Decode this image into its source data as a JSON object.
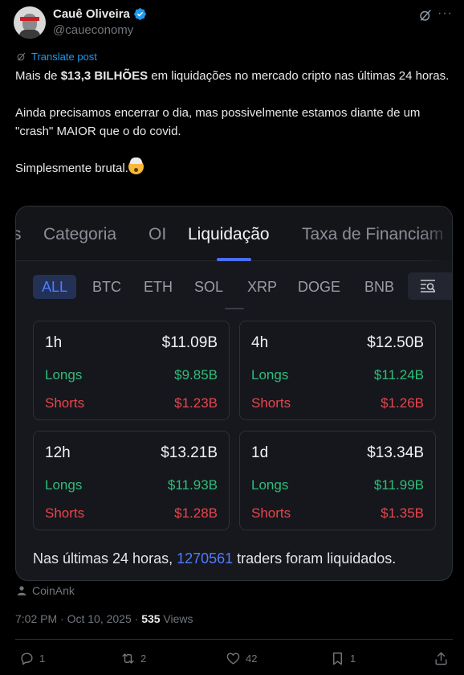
{
  "author": {
    "name": "Cauê Oliveira",
    "handle": "@caueconomy"
  },
  "translate_label": "Translate post",
  "tweet": {
    "p1_prefix": "Mais de ",
    "p1_bold": "$13,3 BILHÕES",
    "p1_suffix": " em liquidações no mercado cripto nas últimas 24 horas.",
    "p2": "Ainda precisamos encerrar o dia, mas possivelmente estamos diante de um \"crash\" MAIOR que o do covid.",
    "p3": "Simplesmente brutal."
  },
  "media": {
    "tabs": [
      "s",
      "Categoria",
      "OI",
      "Liquidação",
      "Taxa de Financiam"
    ],
    "active_tab": "Liquidação",
    "coins": [
      "ALL",
      "BTC",
      "ETH",
      "SOL",
      "XRP",
      "DOGE",
      "BNB"
    ],
    "active_coin": "ALL",
    "cards": [
      {
        "period": "1h",
        "total": "$11.09B",
        "longs_label": "Longs",
        "longs": "$9.85B",
        "shorts_label": "Shorts",
        "shorts": "$1.23B"
      },
      {
        "period": "4h",
        "total": "$12.50B",
        "longs_label": "Longs",
        "longs": "$11.24B",
        "shorts_label": "Shorts",
        "shorts": "$1.26B"
      },
      {
        "period": "12h",
        "total": "$13.21B",
        "longs_label": "Longs",
        "longs": "$11.93B",
        "shorts_label": "Shorts",
        "shorts": "$1.28B"
      },
      {
        "period": "1d",
        "total": "$13.34B",
        "longs_label": "Longs",
        "longs": "$11.99B",
        "shorts_label": "Shorts",
        "shorts": "$1.35B"
      }
    ],
    "summary_prefix": "Nas últimas 24 horas, ",
    "summary_count": "1270561",
    "summary_suffix": " traders foram liquidados."
  },
  "source": "CoinAnk",
  "meta": {
    "timestamp": "7:02 PM · Oct 10, 2025 · ",
    "views_count": "535",
    "views_label": " Views"
  },
  "actions": {
    "replies": "1",
    "reposts": "2",
    "likes": "42",
    "bookmarks": "1"
  },
  "colors": {
    "accent": "#1d9bf0",
    "longs": "#2fbd7a",
    "shorts": "#e8454e",
    "highlight": "#4f7bff"
  }
}
